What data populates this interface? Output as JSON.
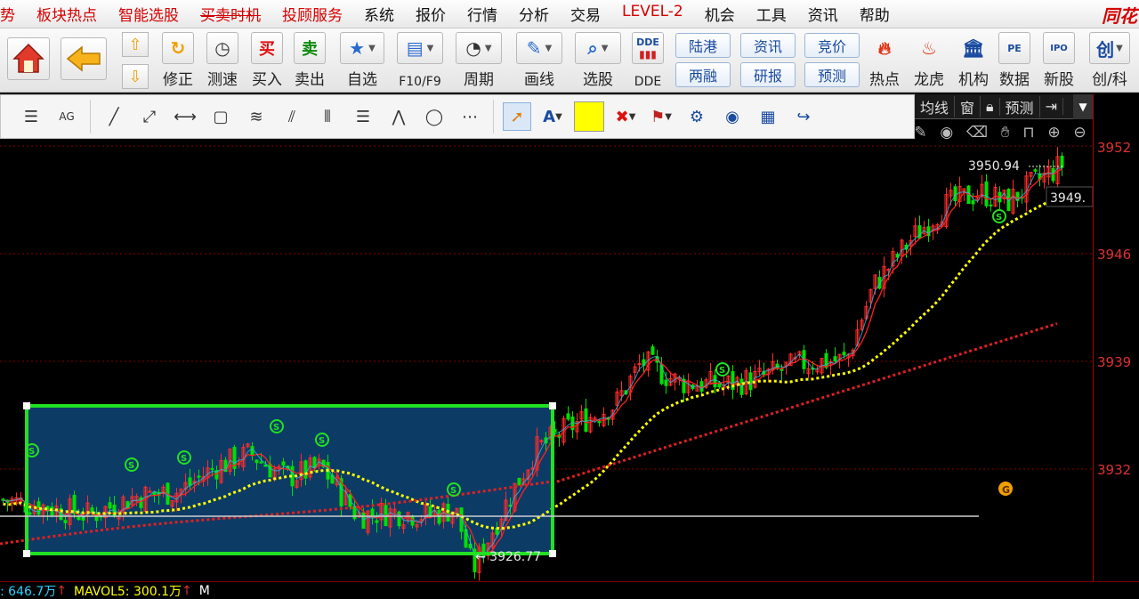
{
  "menu": {
    "items": [
      {
        "label": "势",
        "red": true
      },
      {
        "label": "板块热点",
        "red": true
      },
      {
        "label": "智能选股",
        "red": true
      },
      {
        "label": "买卖时机",
        "red": true,
        "strike": true
      },
      {
        "label": "投顾服务",
        "red": true
      },
      {
        "label": "系统"
      },
      {
        "label": "报价"
      },
      {
        "label": "行情"
      },
      {
        "label": "分析"
      },
      {
        "label": "交易"
      },
      {
        "label": "LEVEL-2",
        "red": true
      },
      {
        "label": "机会"
      },
      {
        "label": "工具"
      },
      {
        "label": "资讯"
      },
      {
        "label": "帮助"
      }
    ],
    "logo": "同花"
  },
  "toolbar": {
    "home_icon": "home-icon",
    "back_icon": "back-arrow-icon",
    "fix_label": "修正",
    "speed_label": "测速",
    "buy_label": "买入",
    "sell_label": "卖出",
    "watch_label": "自选",
    "f10_label": "F10/F9",
    "period_label": "周期",
    "draw_label": "画线",
    "pick_label": "选股",
    "dde_label": "DDE",
    "pills": [
      "陆港",
      "资讯",
      "竞价",
      "两融",
      "研报",
      "预测"
    ],
    "hot_label": "热点",
    "dragon_label": "龙虎",
    "inst_label": "机构",
    "data_label": "数据",
    "ipo_label": "新股",
    "chuangke_label": "创/科"
  },
  "right_bar": {
    "items": [
      "均线",
      "窗",
      "预测"
    ]
  },
  "axis": {
    "ticks": [
      "3952",
      "3946",
      "3939",
      "3932"
    ]
  },
  "chart_data": {
    "type": "candlestick",
    "high_label": "3950.94",
    "last_label": "3949.",
    "low_label": "3926.77",
    "marker_label": "G",
    "sell_marker": "S",
    "y_ticks": [
      3952,
      3946,
      3939,
      3932
    ]
  },
  "bottom": {
    "vol_text": ": 646.7万",
    "mavol_text": "MAVOL5: 300.1万",
    "m_text": "M"
  },
  "colors": {
    "up": "#ff2b2b",
    "down": "#00e000",
    "ma_short": "#ff2020",
    "ma_yellow": "#ffff00",
    "ma_red_dotted": "#e02020",
    "box": "#22e022",
    "box_fill": "#0c3b66"
  }
}
